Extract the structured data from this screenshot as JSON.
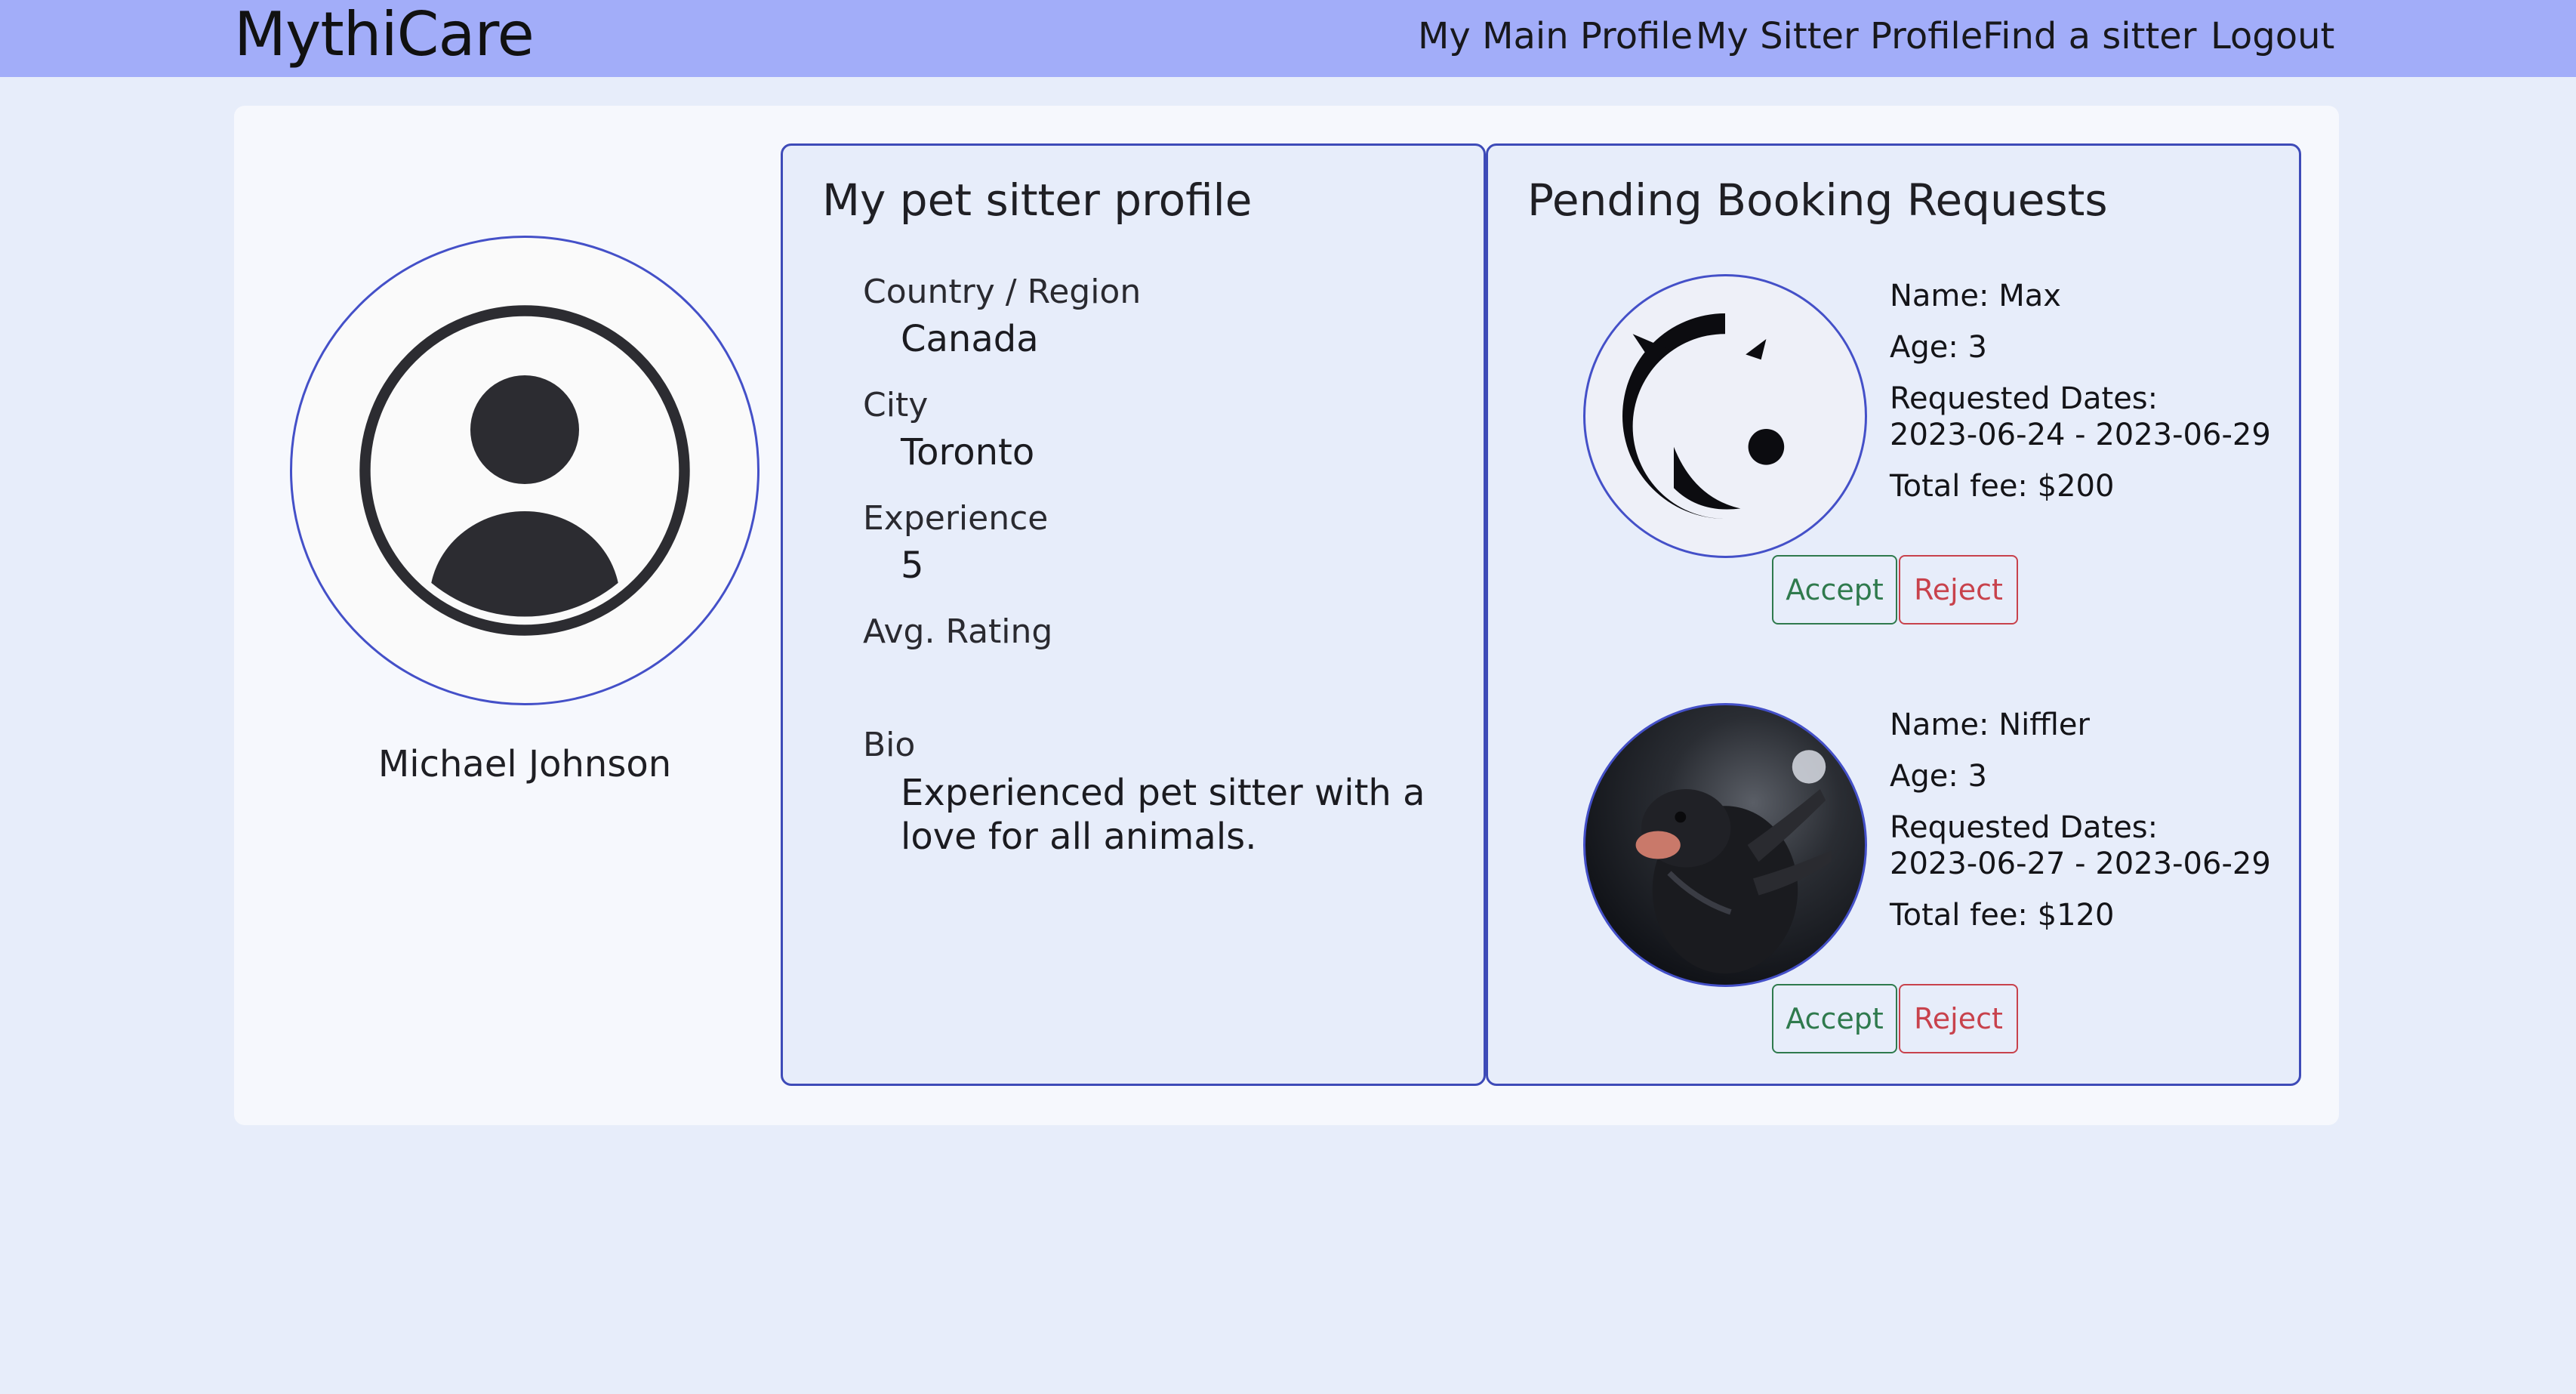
{
  "nav": {
    "brand": "MythiCare",
    "links": [
      "My Main Profile",
      "My Sitter Profile",
      "Find a sitter",
      "Logout"
    ]
  },
  "user": {
    "name": "Michael Johnson",
    "avatar_icon": "user-avatar-icon"
  },
  "profile": {
    "title": "My pet sitter profile",
    "fields": {
      "country_label": "Country / Region",
      "country_value": "Canada",
      "city_label": "City",
      "city_value": "Toronto",
      "experience_label": "Experience",
      "experience_value": "5",
      "rating_label": "Avg. Rating",
      "rating_value": "",
      "bio_label": "Bio",
      "bio_value": "Experienced pet sitter with a love for all animals."
    }
  },
  "requests": {
    "title": "Pending Booking Requests",
    "items": [
      {
        "name": "Name: Max",
        "age": "Age: 3",
        "dates_label": "Requested Dates:",
        "dates": "2023-06-24 - 2023-06-29",
        "fee": "Total fee: $200",
        "photo_icon": "dragon-emblem-icon",
        "accept_label": "Accept",
        "reject_label": "Reject"
      },
      {
        "name": "Name: Niffler",
        "age": "Age: 3",
        "dates_label": "Requested Dates:",
        "dates": "2023-06-27 - 2023-06-29",
        "fee": "Total fee: $120",
        "photo_icon": "niffler-photo",
        "accept_label": "Accept",
        "reject_label": "Reject"
      }
    ]
  },
  "colors": {
    "navbar": "#a2adf9",
    "page_bg": "#e7edfa",
    "panel_border": "#3e4bb8",
    "accept": "#2f7a4d",
    "reject": "#c8424c"
  }
}
